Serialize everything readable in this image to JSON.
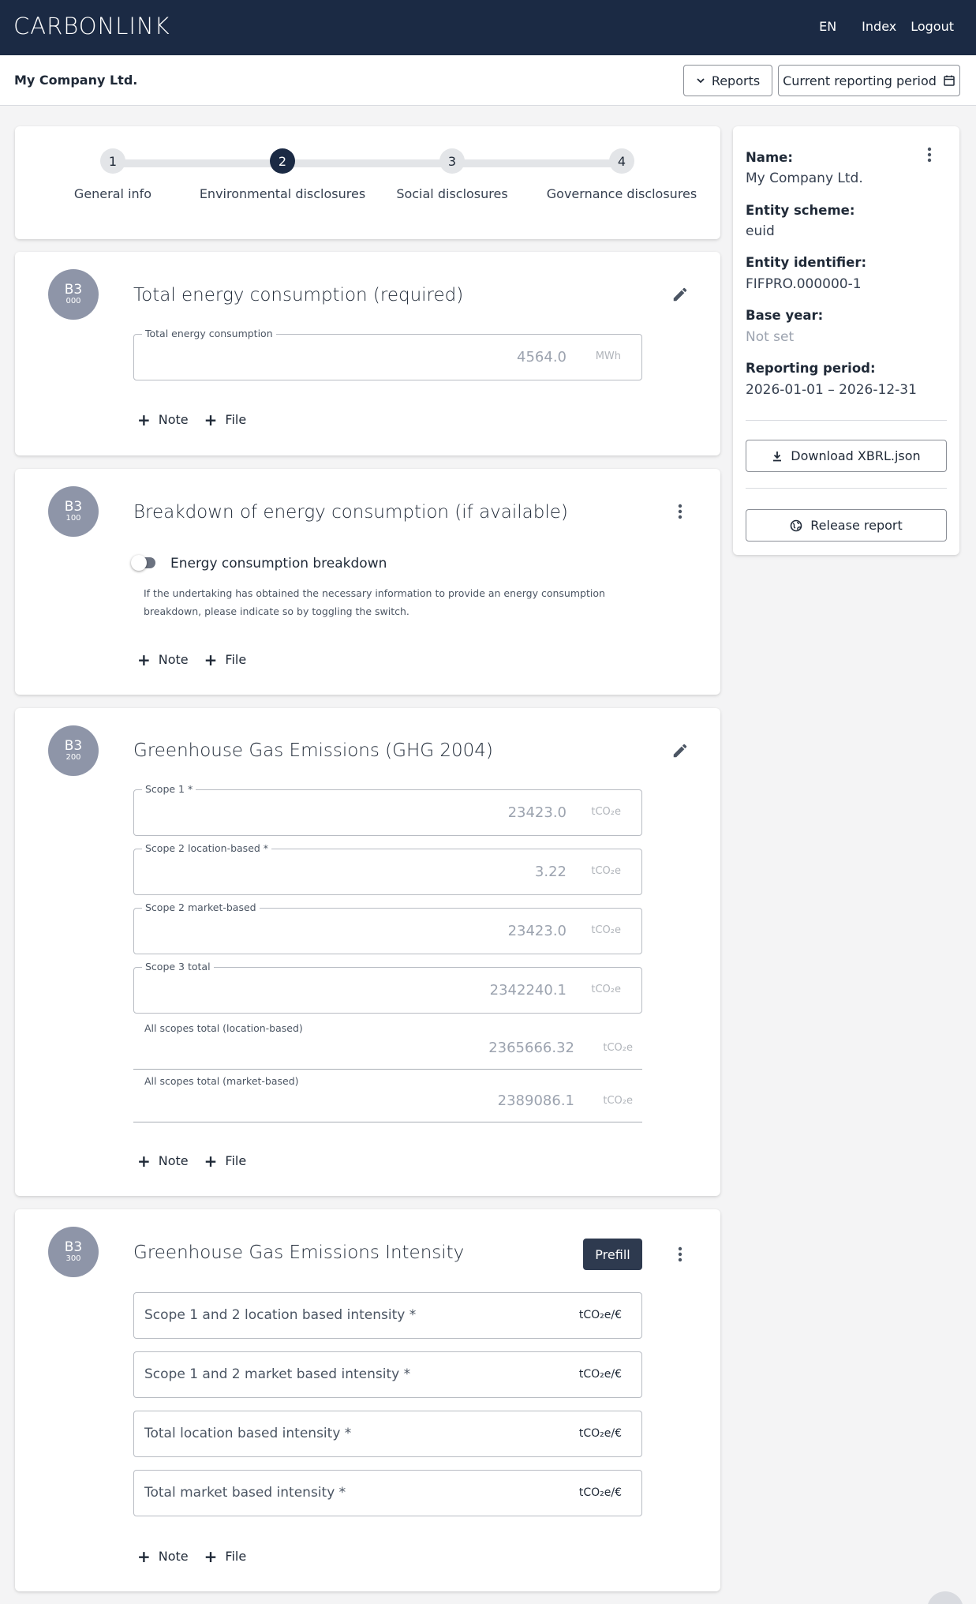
{
  "topbar": {
    "logo": "CARBONLINK",
    "nav": {
      "lang": "EN",
      "index": "Index",
      "logout": "Logout"
    }
  },
  "subheader": {
    "company": "My Company Ltd.",
    "reports_label": "Reports",
    "period_label": "Current reporting period"
  },
  "stepper": {
    "steps": [
      {
        "num": "1",
        "label": "General info"
      },
      {
        "num": "2",
        "label": "Environmental disclosures"
      },
      {
        "num": "3",
        "label": "Social disclosures"
      },
      {
        "num": "4",
        "label": "Governance disclosures"
      }
    ],
    "active": 2
  },
  "sections": {
    "energy": {
      "badge_code": "B3",
      "badge_sub": "000",
      "title": "Total energy consumption (required)",
      "field_label": "Total energy consumption",
      "field_value": "4564.0",
      "field_unit": "MWh"
    },
    "breakdown": {
      "badge_code": "B3",
      "badge_sub": "100",
      "title": "Breakdown of energy consumption (if available)",
      "toggle_label": "Energy consumption breakdown",
      "helper": "If the undertaking has obtained the necessary information to provide an energy consumption breakdown, please indicate so by toggling the switch."
    },
    "ghg": {
      "badge_code": "B3",
      "badge_sub": "200",
      "title": "Greenhouse Gas Emissions (GHG 2004)",
      "fields": [
        {
          "label": "Scope 1 *",
          "value": "23423.0",
          "unit": "tCO₂e"
        },
        {
          "label": "Scope 2 location-based *",
          "value": "3.22",
          "unit": "tCO₂e"
        },
        {
          "label": "Scope 2 market-based",
          "value": "23423.0",
          "unit": "tCO₂e"
        },
        {
          "label": "Scope 3 total",
          "value": "2342240.1",
          "unit": "tCO₂e"
        }
      ],
      "totals": [
        {
          "label": "All scopes total (location-based)",
          "value": "2365666.32",
          "unit": "tCO₂e"
        },
        {
          "label": "All scopes total (market-based)",
          "value": "2389086.1",
          "unit": "tCO₂e"
        }
      ]
    },
    "intensity": {
      "badge_code": "B3",
      "badge_sub": "300",
      "title": "Greenhouse Gas Emissions Intensity",
      "prefill_label": "Prefill",
      "fields": [
        {
          "placeholder": "Scope 1 and 2 location based intensity *",
          "unit": "tCO₂e/€"
        },
        {
          "placeholder": "Scope 1 and 2 market based intensity *",
          "unit": "tCO₂e/€"
        },
        {
          "placeholder": "Total location based intensity *",
          "unit": "tCO₂e/€"
        },
        {
          "placeholder": "Total market based intensity *",
          "unit": "tCO₂e/€"
        }
      ]
    }
  },
  "actions": {
    "note": "Note",
    "file": "File"
  },
  "side": {
    "name_key": "Name:",
    "name_val": "My Company Ltd.",
    "scheme_key": "Entity scheme:",
    "scheme_val": "euid",
    "ident_key": "Entity identifier:",
    "ident_val": "FIFPRO.000000-1",
    "base_key": "Base year:",
    "base_val": "Not set",
    "period_key": "Reporting period:",
    "period_val": "2026-01-01 – 2026-12-31",
    "download_label": "Download XBRL.json",
    "release_label": "Release report"
  }
}
